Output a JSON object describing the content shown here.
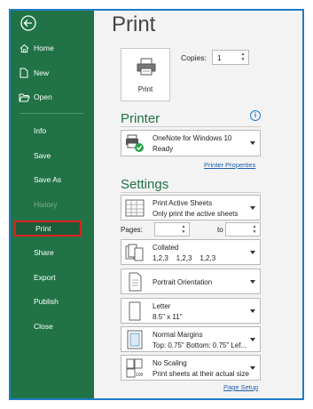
{
  "sidebar": {
    "items": [
      {
        "label": "Home",
        "icon": "home-icon"
      },
      {
        "label": "New",
        "icon": "new-document-icon"
      },
      {
        "label": "Open",
        "icon": "folder-open-icon"
      },
      {
        "label": "Info"
      },
      {
        "label": "Save"
      },
      {
        "label": "Save As"
      },
      {
        "label": "History",
        "disabled": true
      },
      {
        "label": "Print",
        "selected": true
      },
      {
        "label": "Share"
      },
      {
        "label": "Export"
      },
      {
        "label": "Publish"
      },
      {
        "label": "Close"
      }
    ]
  },
  "main": {
    "title": "Print",
    "print_button_label": "Print",
    "copies_label": "Copies:",
    "copies_value": "1",
    "printer": {
      "heading": "Printer",
      "name": "OneNote for Windows 10",
      "status": "Ready",
      "properties_link": "Printer Properties"
    },
    "settings": {
      "heading": "Settings",
      "items": [
        {
          "line1": "Print Active Sheets",
          "line2": "Only print the active sheets"
        },
        {
          "line1": "Collated",
          "line2": "1,2,3    1,2,3    1,2,3"
        },
        {
          "line1": "Portrait Orientation",
          "line2": ""
        },
        {
          "line1": "Letter",
          "line2": "8.5\" x 11\""
        },
        {
          "line1": "Normal Margins",
          "line2": "Top: 0.75\" Bottom: 0.75\" Lef..."
        },
        {
          "line1": "No Scaling",
          "line2": "Print sheets at their actual size"
        }
      ],
      "pages_label": "Pages:",
      "to_label": "to",
      "page_setup_link": "Page Setup"
    }
  },
  "colors": {
    "sidebar_bg": "#217346",
    "accent_green": "#217346",
    "selection_border": "#e02020",
    "frame_border": "#1e7cc7",
    "link": "#1f5fa8"
  }
}
